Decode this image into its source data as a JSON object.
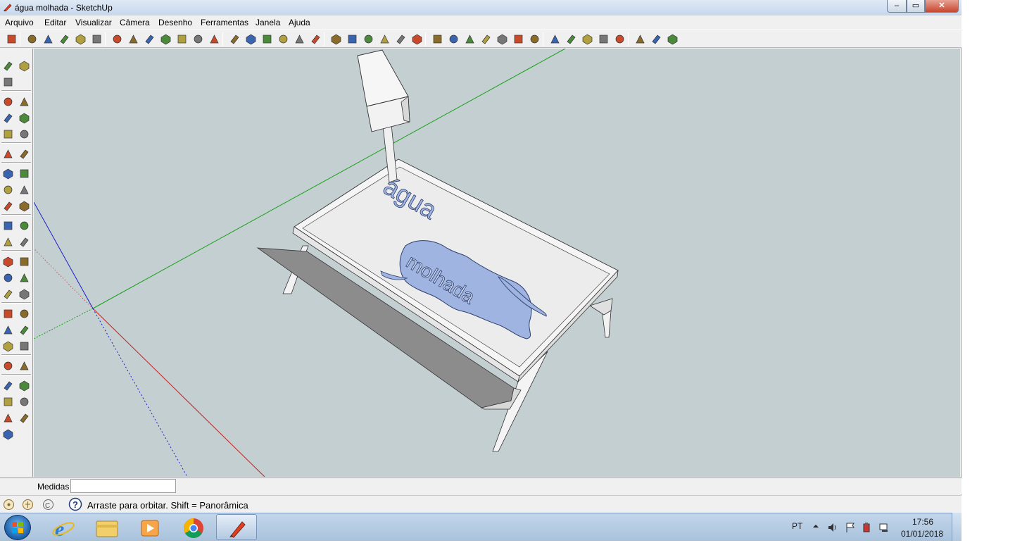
{
  "window": {
    "title": "água molhada - SketchUp",
    "min_symbol": "‒",
    "max_symbol": "▭",
    "close_symbol": "✕"
  },
  "menu": [
    "Arquivo",
    "Editar",
    "Visualizar",
    "Câmera",
    "Desenho",
    "Ferramentas",
    "Janela",
    "Ajuda"
  ],
  "toolbar_icons": [
    "select-icon",
    "pencil-icon",
    "rectangle-icon",
    "circle-icon",
    "arc-icon",
    "make-component-icon",
    "eraser-icon",
    "tape-measure-icon",
    "paint-bucket-icon",
    "push-pull-icon",
    "move-icon",
    "rotate-icon",
    "follow-me-icon",
    "orbit-icon",
    "pan-icon",
    "zoom-icon",
    "zoom-extents-icon",
    "previous-view-icon",
    "next-view-icon",
    "position-camera-icon",
    "walk-icon",
    "look-around-icon",
    "section-plane-icon",
    "xray-icon",
    "back-edges-icon",
    "iso-view-icon",
    "wireframe-icon",
    "hidden-line-icon",
    "shaded-icon",
    "shaded-textures-icon",
    "monochrome-icon",
    "top-view-icon",
    "front-view-icon",
    "right-view-icon",
    "back-view-icon",
    "left-view-icon",
    "bottom-view-icon",
    "add-location-icon",
    "toggle-terrain-icon",
    "photo-textures-icon"
  ],
  "left_toolbar_icons": [
    "new-icon",
    "open-icon",
    "save-icon",
    "cut-icon",
    "copy-icon",
    "paste-icon",
    "delete-icon",
    "undo-icon",
    "redo-icon",
    "print-icon",
    "model-info-icon",
    "tape-measure-icon",
    "dimension-icon",
    "protractor-icon",
    "text-icon",
    "axes-icon",
    "3d-text-icon",
    "select-icon",
    "make-component-icon",
    "paint-bucket-icon",
    "eraser-icon",
    "rectangle-icon",
    "line-icon",
    "circle-icon",
    "arc-icon",
    "polygon-icon",
    "freehand-icon",
    "move-icon",
    "push-pull-icon",
    "rotate-icon",
    "follow-me-icon",
    "scale-icon",
    "offset-icon",
    "orbit-icon",
    "pan-icon",
    "zoom-icon",
    "iso-icon",
    "top-icon",
    "front-icon",
    "right-icon",
    "back-icon",
    "left-icon"
  ],
  "model": {
    "text_top": "água",
    "text_bottom": "molhada"
  },
  "vcb": {
    "label": "Medidas",
    "value": ""
  },
  "status": {
    "text": "Arraste para orbitar. Shift = Panorâmica",
    "help_icon": "?"
  },
  "taskbar": {
    "apps": [
      "internet-explorer-icon",
      "file-explorer-icon",
      "media-player-icon",
      "chrome-icon",
      "sketchup-icon"
    ],
    "language": "PT",
    "time": "17:56",
    "date": "01/01/2018"
  },
  "colors": {
    "viewport_bg": "#c4cfd2",
    "water": "#9fb4e0",
    "axis_red": "#c81e1e",
    "axis_green": "#18a018",
    "axis_blue": "#1e1ec8"
  }
}
